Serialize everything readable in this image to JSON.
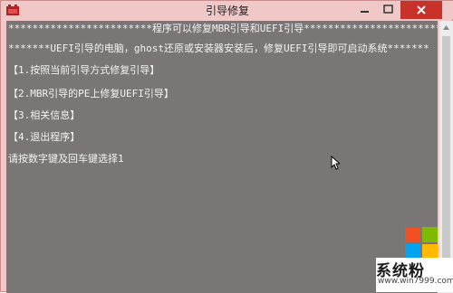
{
  "window": {
    "title": "引导修复"
  },
  "console": {
    "lines": [
      "************************程序可以修复MBR引导和UEFI引导************************",
      "*******UEFI引导的电脑，ghost还原或安装器安装后，修复UEFI引导即可启动系统*******",
      "【1.按照当前引导方式修复引导】",
      "【2.MBR引导的PE上修复UEFI引导】",
      "【3.相关信息】",
      "【4.退出程序】",
      "请按数字键及回车键选择1"
    ]
  },
  "watermark": {
    "name": "系统粉",
    "url": "www.win7999.com",
    "colors": [
      "#f25022",
      "#7fba00",
      "#00a4ef",
      "#ffb900"
    ]
  },
  "colors": {
    "title_bar": "#f1c8c8",
    "console_bg": "#7b7676",
    "console_text": "#f2f2f2",
    "close_button": "#c9322b"
  }
}
